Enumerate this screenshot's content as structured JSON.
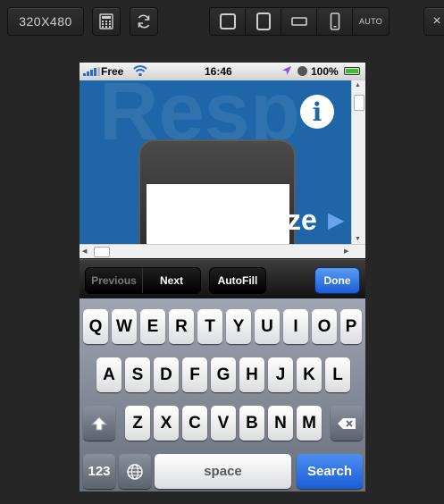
{
  "toolbar": {
    "size_label": "320X480",
    "calculator_icon": "calculator-icon",
    "refresh_icon": "refresh-icon",
    "orientation_icons": [
      "square-frame-icon",
      "tablet-icon",
      "landscape-phone-icon",
      "portrait-phone-icon"
    ],
    "auto_label": "AUTO",
    "close_label": "×"
  },
  "statusbar": {
    "carrier": "Free",
    "time": "16:46",
    "battery_percent": "100%",
    "battery_level": 1.0
  },
  "web": {
    "background_text": "Resp",
    "info_label": "i",
    "headline": "ze",
    "nav_left": "‹",
    "nav_right": "▶"
  },
  "accessory_bar": {
    "previous_label": "Previous",
    "next_label": "Next",
    "autofill_label": "AutoFill",
    "done_label": "Done"
  },
  "keyboard": {
    "row1": [
      "Q",
      "W",
      "E",
      "R",
      "T",
      "Y",
      "U",
      "I",
      "O",
      "P"
    ],
    "row2": [
      "A",
      "S",
      "D",
      "F",
      "G",
      "H",
      "J",
      "K",
      "L"
    ],
    "row3": [
      "Z",
      "X",
      "C",
      "V",
      "B",
      "N",
      "M"
    ],
    "numbers_label": "123",
    "space_label": "space",
    "search_label": "Search"
  },
  "colors": {
    "page_background": "#262626",
    "web_blue": "#1f66a8",
    "done_blue": "#2a6fe0",
    "battery_green": "#3fbf2e"
  }
}
